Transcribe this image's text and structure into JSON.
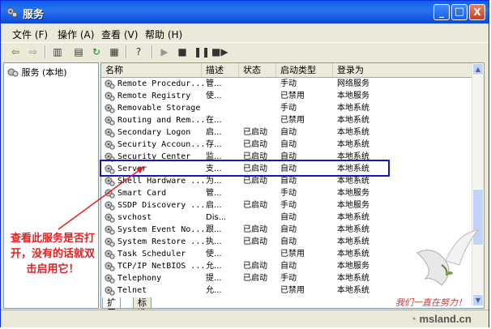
{
  "window": {
    "title": "服务"
  },
  "title_buttons": {
    "minimize": "_",
    "maximize": "□",
    "close": "X"
  },
  "menu": [
    "文件 (F)",
    "操作 (A)",
    "查看 (V)",
    "帮助 (H)"
  ],
  "tree": {
    "root_label": "服务 (本地)"
  },
  "columns": [
    "名称",
    "描述",
    "状态",
    "启动类型",
    "登录为"
  ],
  "services": [
    {
      "name": "Remote Procedur...",
      "desc": "管...",
      "status": "",
      "startup": "手动",
      "logon": "网络服务"
    },
    {
      "name": "Remote Registry",
      "desc": "使...",
      "status": "",
      "startup": "已禁用",
      "logon": "本地服务"
    },
    {
      "name": "Removable Storage",
      "desc": "",
      "status": "",
      "startup": "手动",
      "logon": "本地系统"
    },
    {
      "name": "Routing and Rem...",
      "desc": "在...",
      "status": "",
      "startup": "已禁用",
      "logon": "本地系统"
    },
    {
      "name": "Secondary Logon",
      "desc": "启...",
      "status": "已启动",
      "startup": "自动",
      "logon": "本地系统"
    },
    {
      "name": "Security Accoun...",
      "desc": "存...",
      "status": "已启动",
      "startup": "自动",
      "logon": "本地系统"
    },
    {
      "name": "Security Center",
      "desc": "监...",
      "status": "已启动",
      "startup": "自动",
      "logon": "本地系统"
    },
    {
      "name": "Server",
      "desc": "支...",
      "status": "已启动",
      "startup": "自动",
      "logon": "本地系统"
    },
    {
      "name": "Shell Hardware ...",
      "desc": "为...",
      "status": "已启动",
      "startup": "自动",
      "logon": "本地系统"
    },
    {
      "name": "Smart Card",
      "desc": "管...",
      "status": "",
      "startup": "手动",
      "logon": "本地服务"
    },
    {
      "name": "SSDP Discovery ...",
      "desc": "启...",
      "status": "已启动",
      "startup": "手动",
      "logon": "本地服务"
    },
    {
      "name": "svchost",
      "desc": "Dis...",
      "status": "",
      "startup": "自动",
      "logon": "本地系统"
    },
    {
      "name": "System Event No...",
      "desc": "跟...",
      "status": "已启动",
      "startup": "自动",
      "logon": "本地系统"
    },
    {
      "name": "System Restore ...",
      "desc": "执...",
      "status": "已启动",
      "startup": "自动",
      "logon": "本地系统"
    },
    {
      "name": "Task Scheduler",
      "desc": "使...",
      "status": "",
      "startup": "已禁用",
      "logon": "本地系统"
    },
    {
      "name": "TCP/IP NetBIOS ...",
      "desc": "允...",
      "status": "已启动",
      "startup": "自动",
      "logon": "本地服务"
    },
    {
      "name": "Telephony",
      "desc": "提...",
      "status": "已启动",
      "startup": "手动",
      "logon": "本地系统"
    },
    {
      "name": "Telnet",
      "desc": "允...",
      "status": "",
      "startup": "已禁用",
      "logon": "本地系统"
    }
  ],
  "bottom_tabs": [
    "扩展",
    "标准"
  ],
  "annotation": {
    "text": "查看此服务是否打开，没有的话就双击启用它！"
  },
  "watermark": {
    "slogan": "我们一直在努力！",
    "site": "msland.cn"
  },
  "colors": {
    "titlebar": "#0a5fe8",
    "highlight_box": "#1414c8",
    "annotation": "#e02222"
  }
}
